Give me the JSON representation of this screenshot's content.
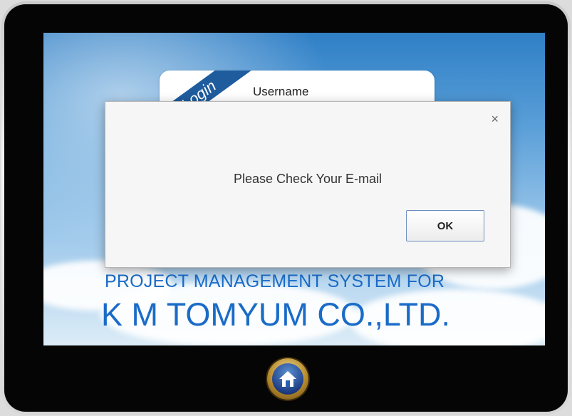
{
  "login": {
    "ribbon_text": "Login",
    "username_label": "Username"
  },
  "brand": {
    "line1": "PROJECT MANAGEMENT SYSTEM FOR",
    "line2": "K M TOMYUM CO.,LTD."
  },
  "dialog": {
    "message": "Please Check Your E-mail",
    "ok_label": "OK",
    "close_glyph": "×"
  },
  "icons": {
    "home": "home-icon",
    "close": "close-icon"
  },
  "colors": {
    "brand_blue": "#1a6bc8",
    "ribbon_blue": "#1f5c9e"
  }
}
